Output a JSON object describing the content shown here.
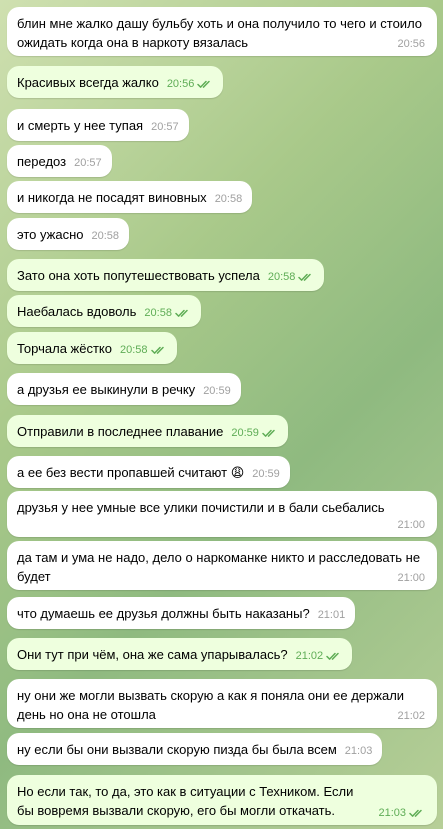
{
  "messages": [
    {
      "dir": "in",
      "text": "блин мне жалко дашу бульбу хоть и она получило то чего и стоило ожидать когда она в наркоту вязалась",
      "time": "20:56"
    },
    {
      "dir": "out",
      "text": "Красивых всегда жалко",
      "time": "20:56"
    },
    {
      "dir": "in",
      "text": "и смерть у нее тупая",
      "time": "20:57"
    },
    {
      "dir": "in",
      "text": "передоз",
      "time": "20:57"
    },
    {
      "dir": "in",
      "text": "и никогда не посадят виновных",
      "time": "20:58"
    },
    {
      "dir": "in",
      "text": "это ужасно",
      "time": "20:58"
    },
    {
      "dir": "out",
      "text": "Зато она хоть попутешествовать успела",
      "time": "20:58"
    },
    {
      "dir": "out",
      "text": "Наебалась вдоволь",
      "time": "20:58"
    },
    {
      "dir": "out",
      "text": "Торчала жёстко",
      "time": "20:58"
    },
    {
      "dir": "in",
      "text": "а друзья ее выкинули в речку",
      "time": "20:59"
    },
    {
      "dir": "out",
      "text": "Отправили в последнее плавание",
      "time": "20:59"
    },
    {
      "dir": "in",
      "text": "а ее без вести пропавшей считают 😩",
      "time": "20:59"
    },
    {
      "dir": "in",
      "text": "друзья у нее умные все улики почистили и в бали сьебались",
      "time": "21:00"
    },
    {
      "dir": "in",
      "text": "да там и ума не надо, дело о наркоманке никто и расследовать не будет",
      "time": "21:00"
    },
    {
      "dir": "in",
      "text": "что думаешь ее друзья должны быть наказаны?",
      "time": "21:01"
    },
    {
      "dir": "out",
      "text": "Они тут при чём, она же сама упарывалась?",
      "time": "21:02"
    },
    {
      "dir": "in",
      "text": "ну они же могли вызвать скорую а как я поняла они ее держали день но она не отошла",
      "time": "21:02"
    },
    {
      "dir": "in",
      "text": "ну если бы они вызвали скорую пизда бы была всем",
      "time": "21:03"
    },
    {
      "dir": "out",
      "text": "Но если так, то да, это как в ситуации с Техником. Если бы вовремя вызвали скорую, его бы могли откачать.",
      "time": "21:03"
    }
  ],
  "colors": {
    "incoming": "#ffffff",
    "outgoing": "#eeffde",
    "checks": "#5fad56",
    "incoming_time": "#a0a0a0"
  },
  "icons": {
    "read_receipt": "double-check-icon"
  }
}
